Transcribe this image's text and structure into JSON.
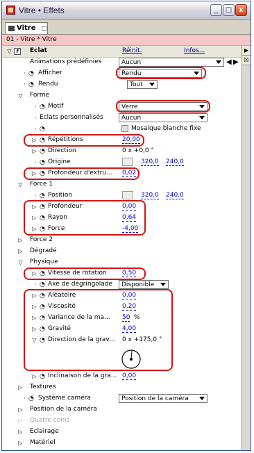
{
  "window": {
    "title": "Vitre • Effets"
  },
  "window_buttons": {
    "minimize": "_",
    "maximize": "□",
    "close": "x"
  },
  "tab": {
    "label": "Vitre",
    "menu": "□"
  },
  "subheader": {
    "text": "01 - Vitre * Vitre"
  },
  "effect": {
    "name": "Eclat",
    "reset": "Réinit.",
    "info": "Infos..."
  },
  "rows": {
    "animations_label": "Animations prédéfinies",
    "animations_value": "Aucun",
    "afficher_label": "Afficher",
    "afficher_value": "Rendu",
    "rendu_label": "Rendu",
    "rendu_value": "Tout",
    "forme_label": "Forme",
    "motif_label": "Motif",
    "motif_value": "Verre",
    "eclats_label": "Eclats personnalisés",
    "eclats_value": "Aucun",
    "mosaique_label": "Mosaique blanche fixe",
    "repetitions_label": "Répétitions",
    "repetitions_value": "20,00",
    "direction_label": "Direction",
    "direction_value": "0 x +0,0 °",
    "origine_label": "Origine",
    "origine_x": "320,0",
    "origine_y": "240,0",
    "profondeur_extru_label": "Profondeur d'extru...",
    "profondeur_extru_value": "0,02",
    "force1_label": "Force 1",
    "position_label": "Position",
    "position_x": "320,0",
    "position_y": "240,0",
    "profondeur_label": "Profondeur",
    "profondeur_value": "0,00",
    "rayon_label": "Rayon",
    "rayon_value": "0,64",
    "force_label": "Force",
    "force_value": "-4,00",
    "force2_label": "Force 2",
    "degrade_label": "Dégradé",
    "physique_label": "Physique",
    "vitesse_label": "Vitesse de rotation",
    "vitesse_value": "0,50",
    "axe_label": "Axe de dégringolade",
    "axe_value": "Disponible",
    "aleatoire_label": "Aléatoire",
    "aleatoire_value": "0,00",
    "viscosite_label": "Viscosité",
    "viscosite_value": "0,20",
    "variance_label": "Variance de la ma...",
    "variance_value": "50",
    "variance_unit": "%",
    "gravite_label": "Gravité",
    "gravite_value": "4,00",
    "direction_grav_label": "Direction de la grav...",
    "direction_grav_value": "0 x +175,0 °",
    "inclinaison_label": "Inclinaison de la gra...",
    "inclinaison_value": "0,00",
    "textures_label": "Textures",
    "systeme_label": "Système caméra",
    "systeme_value": "Position de la caméra",
    "position_camera_label": "Position de la caméra",
    "quatre_coins_label": "Quatre coins",
    "eclairage_label": "Eclairage",
    "materiel_label": "Matériel"
  },
  "colors": {
    "accent": "#d41414",
    "value_blue": "#0000c8",
    "subheader": "#f7c6c6"
  }
}
